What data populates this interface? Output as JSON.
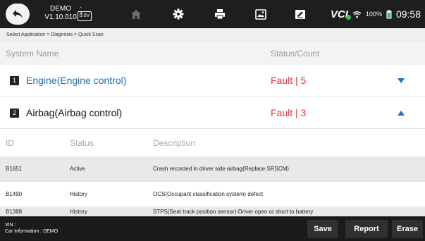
{
  "topbar": {
    "demo_title": "DEMO",
    "version": "V1.10.010",
    "battery_voltage": "0.0V",
    "vci_label": "VCI",
    "battery_percent": "100%",
    "clock": "09:58"
  },
  "breadcrumb": "Select Application > Diagnosis > Quick Scan",
  "table_header": {
    "system_name": "System Name",
    "status_count": "Status/Count"
  },
  "systems": [
    {
      "index": "1",
      "name": "Engine(Engine control)",
      "status": "Fault | 5",
      "expanded": false
    },
    {
      "index": "2",
      "name": "Airbag(Airbag control)",
      "status": "Fault | 3",
      "expanded": true
    }
  ],
  "dtc_header": {
    "id": "ID",
    "status": "Status",
    "description": "Description"
  },
  "dtc_rows": [
    {
      "id": "B1651",
      "status": "Active",
      "description": "Crash recorded in driver side airbag(Replace SRSCM)"
    },
    {
      "id": "B1490",
      "status": "History",
      "description": "OCS(Occupant classification system) defect"
    },
    {
      "id": "B1388",
      "status": "History",
      "description": "STPS(Seat track position sensor)-Driver open or short to battery"
    }
  ],
  "bottombar": {
    "vin_label": "VIN :",
    "car_info": "Car Information : DEMO",
    "save_label": "Save",
    "report_label": "Report",
    "erase_label": "Erase"
  },
  "colors": {
    "topbar_bg": "#1e1e1e",
    "engine_link": "#1f6fb2",
    "fault_red": "#e8303a",
    "arrow_blue": "#1a73c8",
    "vci_green": "#36c35e"
  }
}
